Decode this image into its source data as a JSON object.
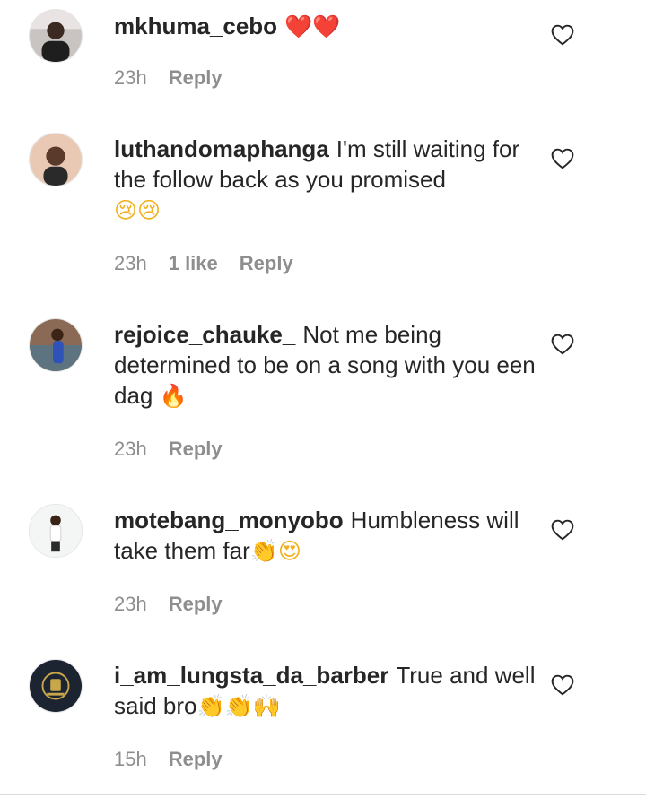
{
  "comments": [
    {
      "username": "mkhuma_cebo",
      "text": "",
      "emoji": "❤️❤️",
      "emoji_color": "red",
      "time": "23h",
      "likes": "",
      "reply": "Reply",
      "avatar": "profile-photo"
    },
    {
      "username": "luthandomaphanga",
      "text": "I'm still waiting for the follow back as you promised",
      "emoji": "😢😢",
      "emoji_color": "yellow",
      "time": "23h",
      "likes": "1 like",
      "reply": "Reply",
      "avatar": "profile-photo"
    },
    {
      "username": "rejoice_chauke_",
      "text": "Not me being determined to be on a song with you een dag",
      "emoji": "🔥",
      "emoji_color": "orange",
      "time": "23h",
      "likes": "",
      "reply": "Reply",
      "avatar": "profile-photo"
    },
    {
      "username": "motebang_monyobo",
      "text": "Humbleness will take them far",
      "emoji": "👏😍",
      "emoji_color": "yellow",
      "time": "23h",
      "likes": "",
      "reply": "Reply",
      "avatar": "profile-photo"
    },
    {
      "username": "i_am_lungsta_da_barber",
      "text": "True and well said bro",
      "emoji": "👏👏🙌",
      "emoji_color": "yellow",
      "time": "15h",
      "likes": "",
      "reply": "Reply",
      "avatar": "logo"
    }
  ],
  "colors": {
    "text": "#262626",
    "meta": "#8e8e8e",
    "background": "#ffffff"
  },
  "icons": {
    "like": "heart-outline-icon"
  }
}
